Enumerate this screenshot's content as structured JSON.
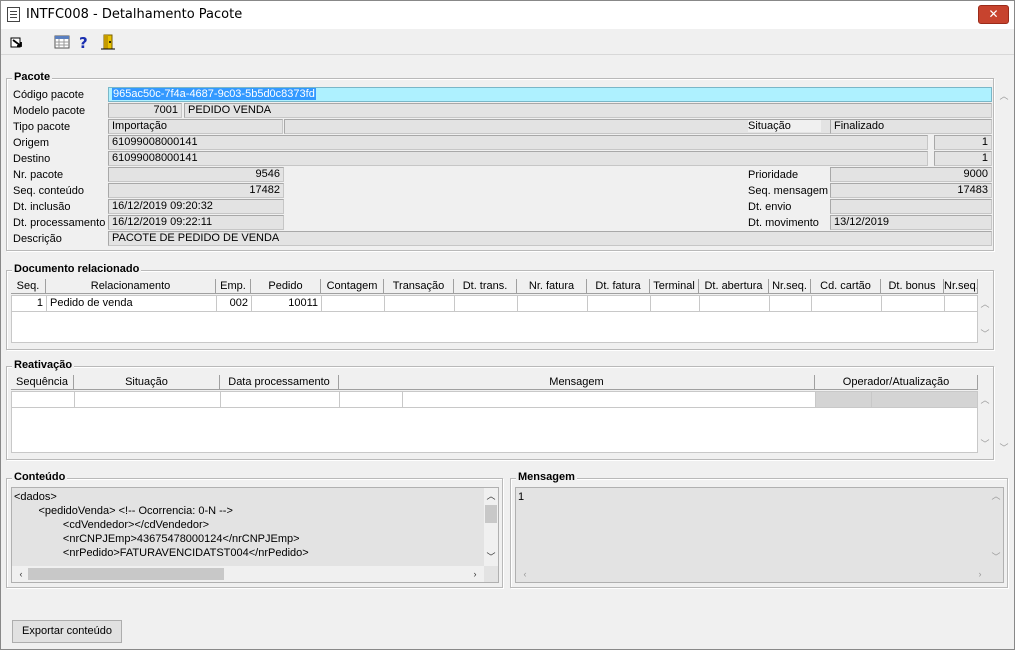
{
  "window": {
    "title": "INTFC008 - Detalhamento Pacote",
    "close_label": "✕"
  },
  "toolbar": {
    "icons": [
      "exit-icon",
      "grid-icon",
      "help-icon",
      "door-icon"
    ]
  },
  "pacote": {
    "group_title": "Pacote",
    "labels": {
      "codigo": "Código pacote",
      "modelo": "Modelo pacote",
      "tipo": "Tipo pacote",
      "origem": "Origem",
      "destino": "Destino",
      "nr_pacote": "Nr. pacote",
      "seq_conteudo": "Seq. conteúdo",
      "dt_inclusao": "Dt. inclusão",
      "dt_processamento": "Dt. processamento",
      "descricao": "Descrição",
      "situacao": "Situação",
      "prioridade": "Prioridade",
      "seq_mensagem": "Seq. mensagem",
      "dt_envio": "Dt. envio",
      "dt_movimento": "Dt. movimento"
    },
    "values": {
      "codigo": "965ac50c-7f4a-4687-9c03-5b5d0c8373fd",
      "modelo_num": "7001",
      "modelo_nome": "PEDIDO VENDA",
      "tipo": "Importação",
      "situacao": "Finalizado",
      "origem": "61099008000141",
      "origem_seq": "1",
      "destino": "61099008000141",
      "destino_seq": "1",
      "nr_pacote": "9546",
      "seq_conteudo": "17482",
      "dt_inclusao": "16/12/2019 09:20:32",
      "dt_processamento": "16/12/2019 09:22:11",
      "descricao": "PACOTE DE PEDIDO DE VENDA",
      "prioridade": "9000",
      "seq_mensagem": "17483",
      "dt_envio": "",
      "dt_movimento": "13/12/2019"
    }
  },
  "documento": {
    "group_title": "Documento relacionado",
    "columns": [
      "Seq.",
      "Relacionamento",
      "Emp.",
      "Pedido",
      "Contagem",
      "Transação",
      "Dt. trans.",
      "Nr. fatura",
      "Dt. fatura",
      "Terminal",
      "Dt. abertura",
      "Nr.seq.",
      "Cd. cartão",
      "Dt. bonus",
      "Nr.seq."
    ],
    "rows": [
      [
        "1",
        "Pedido de venda",
        "002",
        "10011",
        "",
        "",
        "",
        "",
        "",
        "",
        "",
        "",
        "",
        "",
        ""
      ]
    ]
  },
  "reativacao": {
    "group_title": "Reativação",
    "columns": [
      "Sequência",
      "Situação",
      "Data processamento",
      "Mensagem",
      "Operador/Atualização"
    ]
  },
  "conteudo": {
    "group_title": "Conteúdo",
    "lines": [
      "<dados>",
      "        <pedidoVenda> <!-- Ocorrencia: 0-N -->",
      "                <cdVendedor></cdVendedor>",
      "                <nrCNPJEmp>43675478000124</nrCNPJEmp>",
      "                <nrPedido>FATURAVENCIDATST004</nrPedido>"
    ]
  },
  "mensagem": {
    "group_title": "Mensagem",
    "text": "1"
  },
  "actions": {
    "exportar_label": "Exportar conteúdo"
  }
}
